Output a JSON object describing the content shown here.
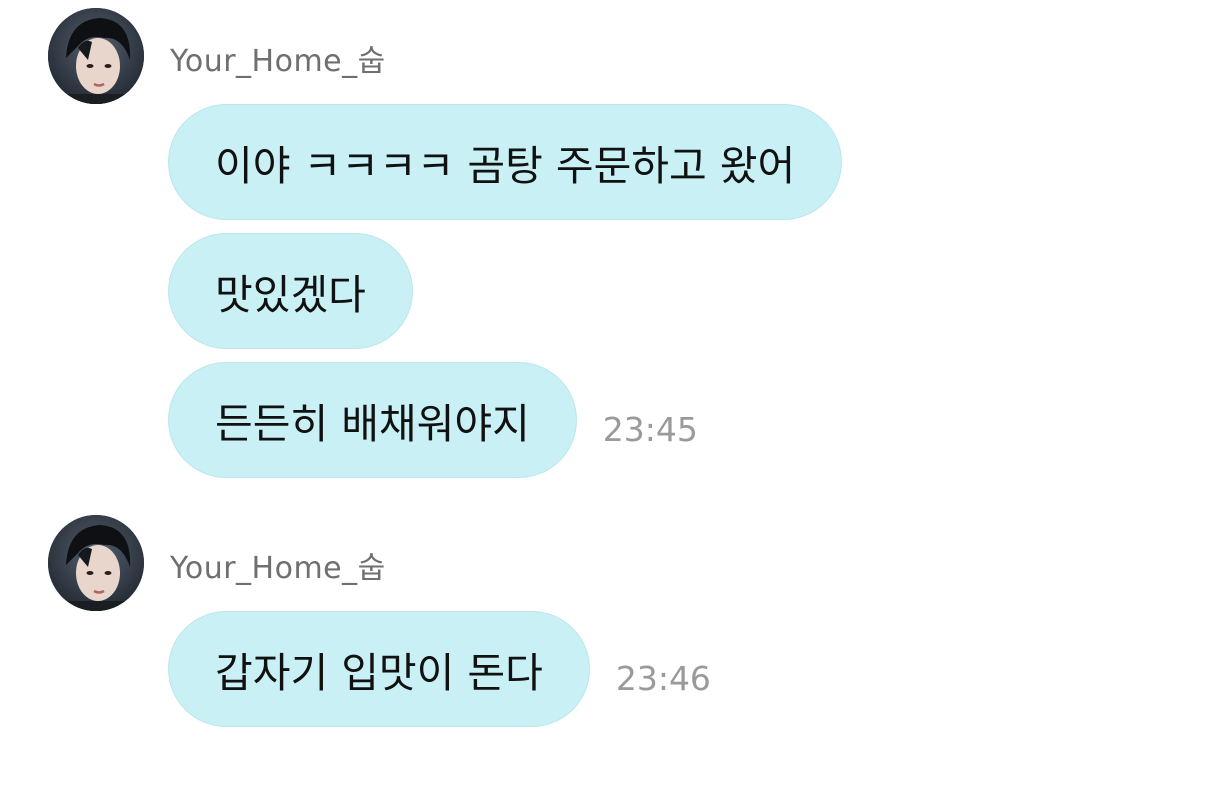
{
  "groups": [
    {
      "sender": "Your_Home_숩",
      "messages": [
        {
          "text": "이야 ㅋㅋㅋㅋ 곰탕 주문하고 왔어",
          "time": ""
        },
        {
          "text": "맛있겠다",
          "time": ""
        },
        {
          "text": "든든히 배채워야지",
          "time": "23:45"
        }
      ]
    },
    {
      "sender": "Your_Home_숩",
      "messages": [
        {
          "text": "갑자기 입맛이 돈다",
          "time": "23:46"
        }
      ]
    }
  ],
  "colors": {
    "bubble": "#c8f0f5",
    "sender_text": "#6f6f6f",
    "time_text": "#9a9a9a",
    "message_text": "#111111"
  },
  "icons": {
    "avatar": "profile-photo-avatar"
  }
}
